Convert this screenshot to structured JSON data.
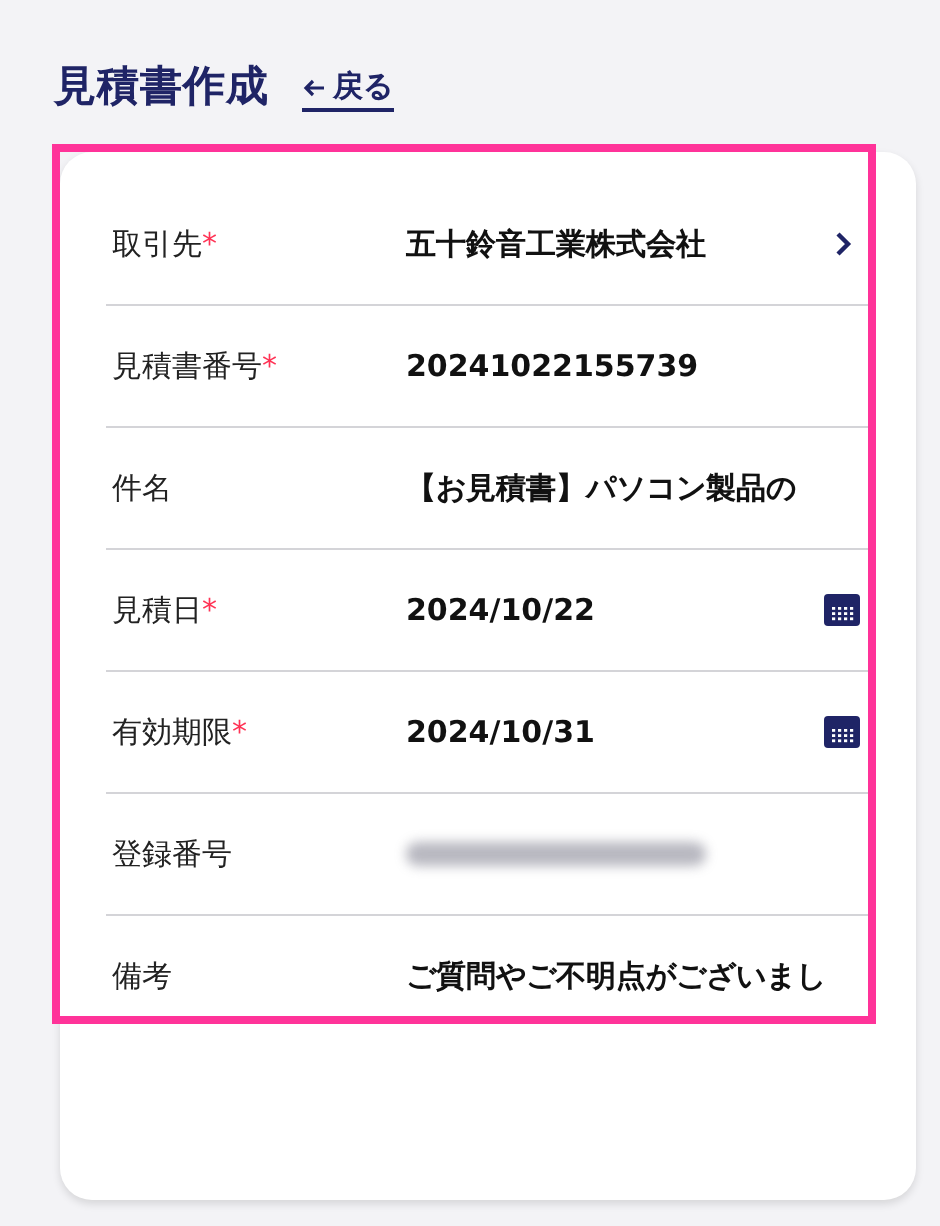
{
  "header": {
    "title": "見積書作成",
    "back_link": "戻る"
  },
  "form": {
    "highlighted": true,
    "rows": [
      {
        "label": "取引先",
        "required_mark": "*",
        "kind": "link",
        "value": "五十鈴音工業株式会社"
      },
      {
        "label": "見積書番号",
        "required_mark": "*",
        "kind": "text",
        "value": "20241022155739"
      },
      {
        "label": "件名",
        "kind": "text",
        "value": "【お見積書】パソコン製品の"
      },
      {
        "label": "見積日",
        "required_mark": "*",
        "kind": "date",
        "value": "2024/10/22"
      },
      {
        "label": "有効期限",
        "required_mark": "*",
        "kind": "date",
        "value": "2024/10/31"
      },
      {
        "label": "登録番号",
        "kind": "redacted"
      },
      {
        "label": "備考",
        "kind": "text",
        "value": "ご質問やご不明点がございまし"
      }
    ]
  }
}
